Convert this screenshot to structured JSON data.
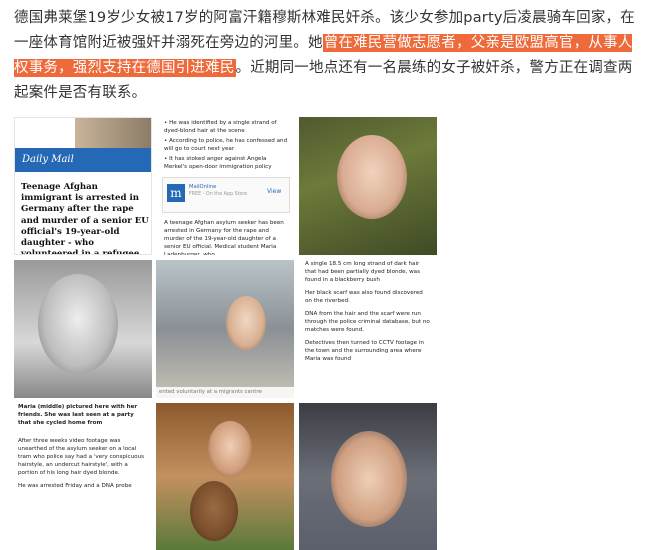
{
  "post": {
    "text_before": "德国弗莱堡19岁少女被17岁的阿富汗籍穆斯林难民奸杀。该少女参加party后凌晨骑车回家，在一座体育馆附近被强奸并溺死在旁边的河里。她",
    "highlight": "曾在难民营做志愿者，父亲是欧盟高官，从事人权事务，强烈支持在德国引进难民",
    "text_after": "。近期同一地点还有一名晨练的女子被奸杀，警方正在调查两起案件是否有联系。",
    "highlight_color": "#ef6a3b"
  },
  "tiles": {
    "t1": {
      "logo": "Daily Mail",
      "headline": "Teenage Afghan immigrant is arrested in Germany after the rape and murder of a senior EU official's 19-year-old daughter - who volunteered in a refugee home"
    },
    "t2": {
      "bullets": [
        "• He was identified by a single strand of dyed-blond hair at the scene",
        "• According to police, he has confessed and will go to court next year",
        "• It has stoked anger against Angela Merkel's open-door immigration policy"
      ],
      "card_title": "MailOnline",
      "card_sub": "FREE - On the App Store",
      "card_view": "View",
      "paragraph": "A teenage Afghan asylum seeker has been arrested in Germany for the rape and murder of the 19-year-old daughter of a senior EU official. Medical student Maria Ladenburger, who"
    },
    "t5": {
      "caption": "ented voluntarily at a migrants centre"
    },
    "t6": {
      "paragraphs": [
        "A single 18.5 cm long strand of dark hair that had been partially dyed blonde, was found in a blackberry bush",
        "Her black scarf was also found discovered on the riverbed.",
        "DNA from the hair and the scarf were run through the police criminal database, but no matches were found.",
        "Detectives then turned to CCTV footage in the town and the surrounding area where Maria was found"
      ]
    },
    "t7": {
      "caption": "Maria (middle) pictured here with her friends. She was last seen at a party that she cycled home from",
      "paragraphs": [
        "After three weeks video footage was unearthed of the asylum seeker on a local tram who police say had a 'very conspicuous hairstyle, an undercut hairstyle', with a portion of his long hair dyed blonde.",
        "He was arrested Friday and a DNA probe"
      ]
    }
  }
}
